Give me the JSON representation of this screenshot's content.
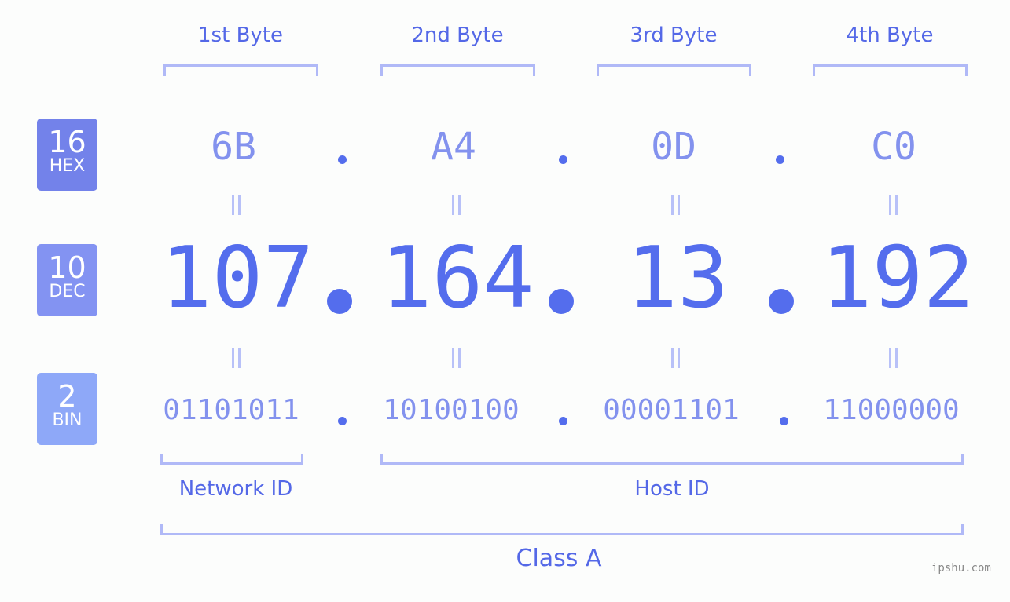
{
  "bytes": [
    {
      "label": "1st Byte",
      "hex": "6B",
      "dec": "107",
      "bin": "01101011"
    },
    {
      "label": "2nd Byte",
      "hex": "A4",
      "dec": "164",
      "bin": "10100100"
    },
    {
      "label": "3rd Byte",
      "hex": "0D",
      "dec": "13",
      "bin": "00001101"
    },
    {
      "label": "4th Byte",
      "hex": "C0",
      "dec": "192",
      "bin": "11000000"
    }
  ],
  "badges": {
    "hex": {
      "num": "16",
      "label": "HEX",
      "color": "#7382ea"
    },
    "dec": {
      "num": "10",
      "label": "DEC",
      "color": "#8393f2"
    },
    "bin": {
      "num": "2",
      "label": "BIN",
      "color": "#8ea8f8"
    }
  },
  "separator": ".",
  "network_label": "Network ID",
  "host_label": "Host ID",
  "class_label": "Class A",
  "watermark": "ipshu.com",
  "colors": {
    "primary": "#546ded",
    "light": "#8392ee",
    "bracket": "#b0b9f7",
    "background": "#fcfdfc"
  }
}
